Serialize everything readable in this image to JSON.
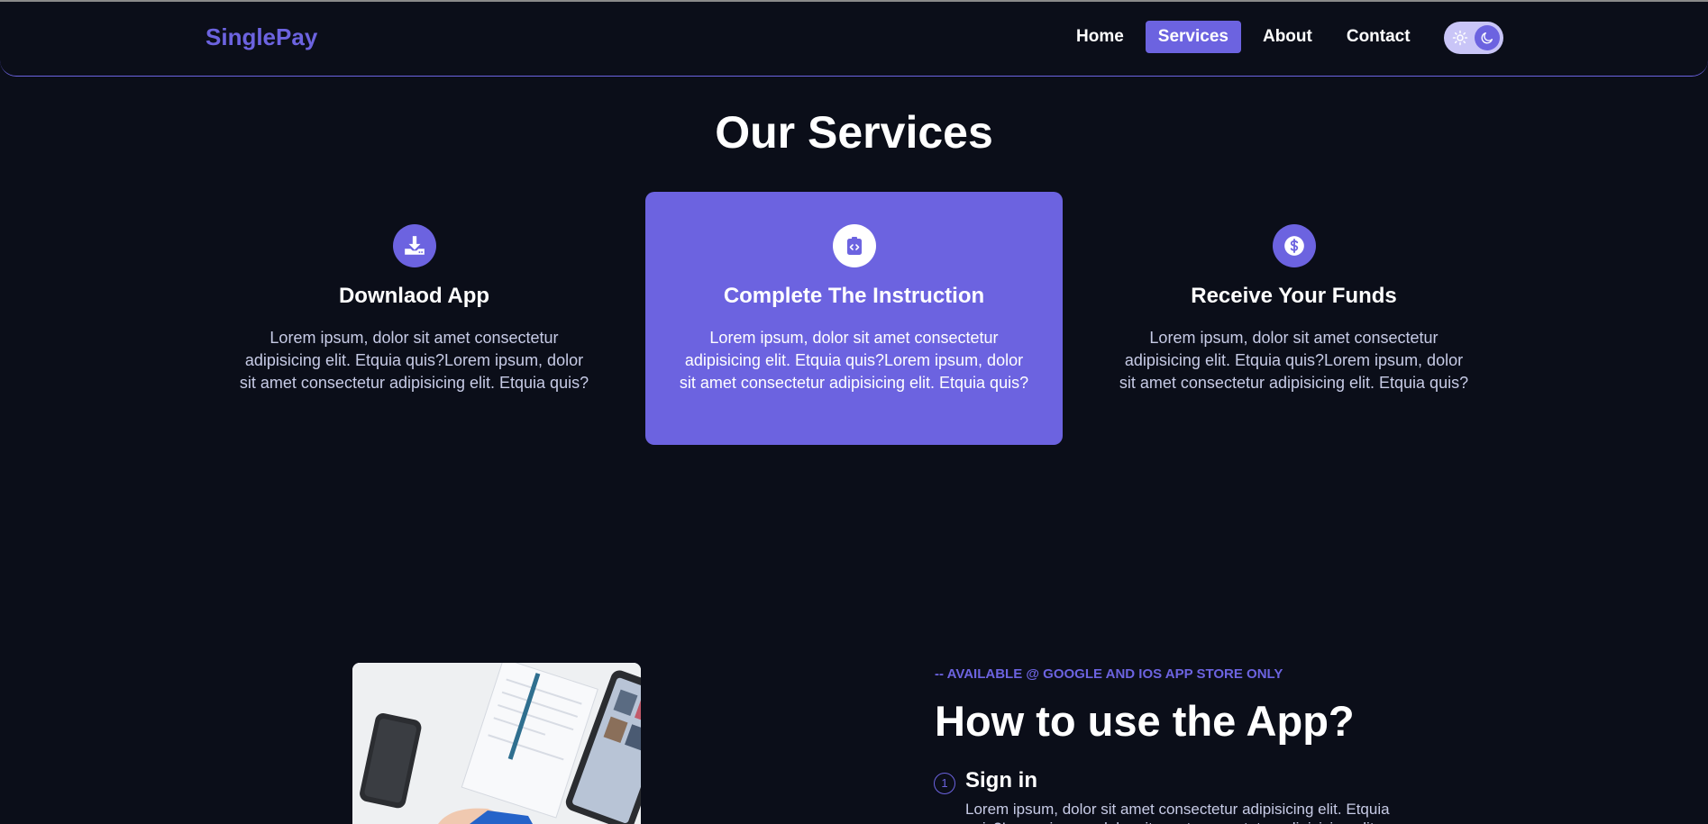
{
  "brand": {
    "name": "SinglePay",
    "accent": "#6c63e0",
    "background": "#0b0e19"
  },
  "nav": {
    "links": [
      {
        "label": "Home",
        "active": false
      },
      {
        "label": "Services",
        "active": true
      },
      {
        "label": "About",
        "active": false
      },
      {
        "label": "Contact",
        "active": false
      }
    ],
    "theme_toggle": {
      "icons": [
        "sun-icon",
        "moon-icon"
      ],
      "selected": "dark"
    }
  },
  "services": {
    "title": "Our Services",
    "cards": [
      {
        "icon": "download-icon",
        "title": "Downlaod App",
        "text": "Lorem ipsum, dolor sit amet consectetur adipisicing elit. Etquia quis?Lorem ipsum, dolor sit amet consectetur adipisicing elit. Etquia quis?",
        "highlighted": false
      },
      {
        "icon": "code-icon",
        "title": "Complete The Instruction",
        "text": "Lorem ipsum, dolor sit amet consectetur adipisicing elit. Etquia quis?Lorem ipsum, dolor sit amet consectetur adipisicing elit. Etquia quis?",
        "highlighted": true
      },
      {
        "icon": "dollar-icon",
        "title": "Receive Your Funds",
        "text": "Lorem ipsum, dolor sit amet consectetur adipisicing elit. Etquia quis?Lorem ipsum, dolor sit amet consectetur adipisicing elit. Etquia quis?",
        "highlighted": false
      }
    ]
  },
  "how_to": {
    "kicker": "-- AVAILABLE @ GOOGLE AND IOS APP STORE ONLY",
    "title": "How to use the App?",
    "steps": [
      {
        "number": "1",
        "title": "Sign in",
        "text": "Lorem ipsum, dolor sit amet consectetur adipisicing elit. Etquia quis?Lorem ipsum, dolor sit amet consectetur adipisicing elit."
      }
    ]
  }
}
